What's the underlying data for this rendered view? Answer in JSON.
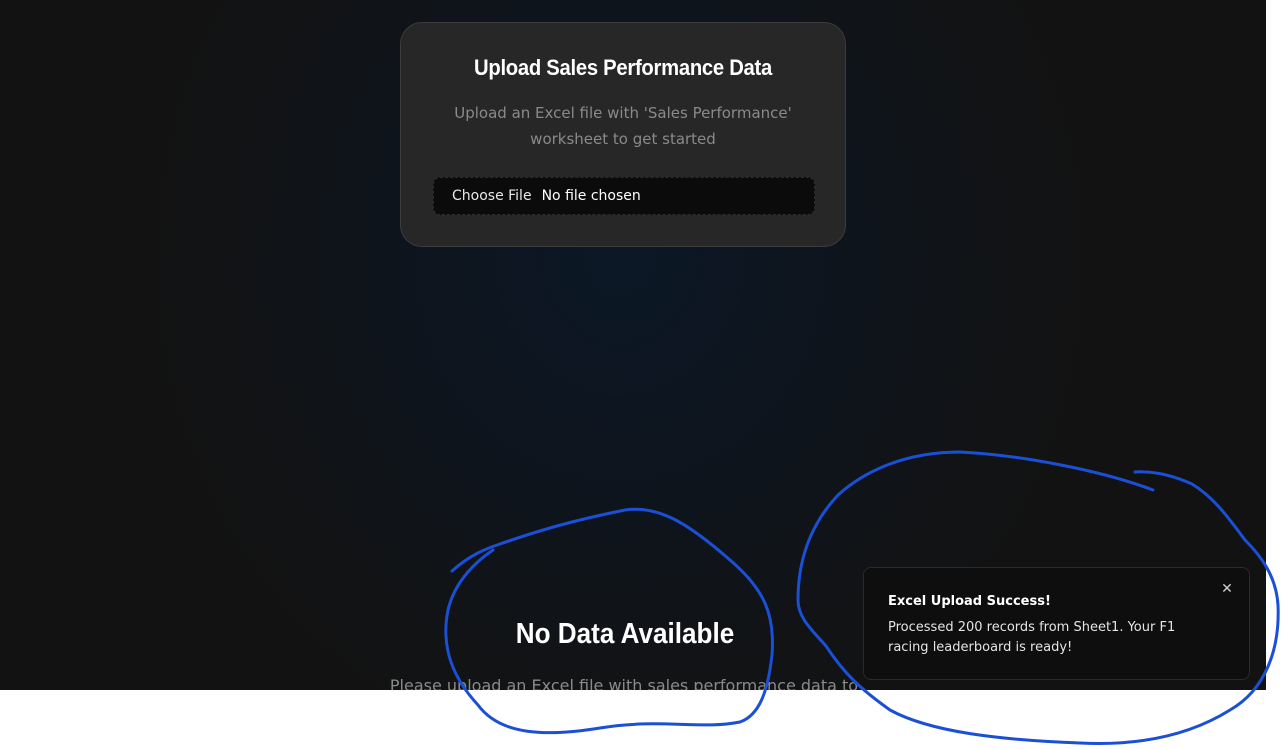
{
  "upload": {
    "title": "Upload Sales Performance Data",
    "subtitle": "Upload an Excel file with 'Sales Performance' worksheet to get started",
    "file_button_label": "Choose File",
    "file_status": "No file chosen"
  },
  "empty_state": {
    "title": "No Data Available",
    "subtitle": "Please upload an Excel file with sales performance data to"
  },
  "toast": {
    "title": "Excel Upload Success!",
    "message": "Processed 200 records from Sheet1. Your F1 racing leaderboard is ready!",
    "close_icon": "close-icon"
  },
  "colors": {
    "background": "#121212",
    "card": "#272727",
    "annotation_stroke": "#1a4fd6"
  }
}
